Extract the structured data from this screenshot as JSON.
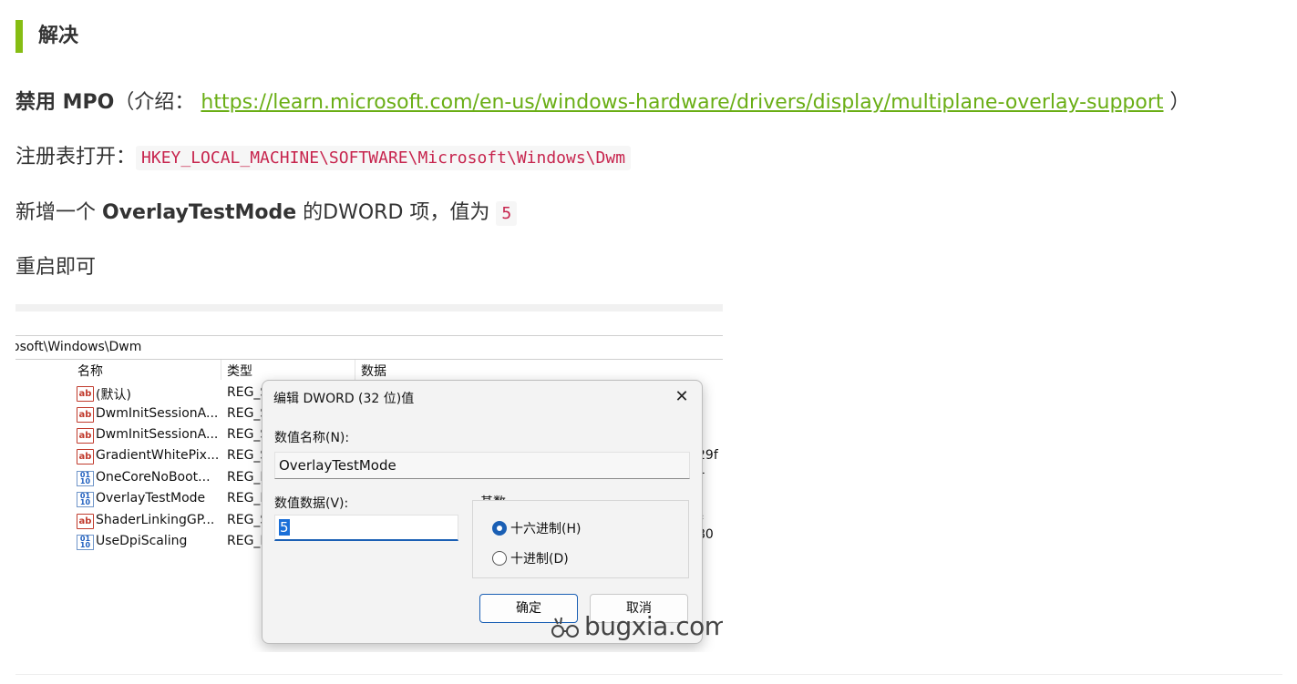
{
  "heading": "解决",
  "p1": {
    "bold": "禁用 MPO",
    "before_link": "（介绍：",
    "link": "https://learn.microsoft.com/en-us/windows-hardware/drivers/display/multiplane-overlay-support",
    "after_link": "）"
  },
  "p2": {
    "text": "注册表打开：",
    "code": "HKEY_LOCAL_MACHINE\\SOFTWARE\\Microsoft\\Windows\\Dwm"
  },
  "p3": {
    "before": "新增一个 ",
    "bold": "OverlayTestMode",
    "after": " 的DWORD 项，值为",
    "code": "5"
  },
  "p4": "重启即可",
  "screenshot": {
    "address": "osoft\\Windows\\Dwm",
    "columns": [
      "名称",
      "类型",
      "数据"
    ],
    "rows": [
      {
        "icon": "ab",
        "name": "(默认)",
        "type": "REG_S"
      },
      {
        "icon": "ab",
        "name": "DwmInitSessionA...",
        "type": "REG_S"
      },
      {
        "icon": "ab",
        "name": "DwmInitSessionA...",
        "type": "REG_S"
      },
      {
        "icon": "ab",
        "name": "GradientWhitePix...",
        "type": "REG_S"
      },
      {
        "icon": "bin",
        "name": "OneCoreNoBoot...",
        "type": "REG_I"
      },
      {
        "icon": "bin",
        "name": "OverlayTestMode",
        "type": "REG_I"
      },
      {
        "icon": "ab",
        "name": "ShaderLinkingGP...",
        "type": "REG_S"
      },
      {
        "icon": "bin",
        "name": "UseDpiScaling",
        "type": "REG_I"
      }
    ],
    "right_clip_1": "29f 1",
    "right_clip_2": "* 80",
    "icon_labels": {
      "ab": "ab",
      "bin": "01\n10"
    },
    "dialog": {
      "title": "编辑 DWORD (32 位)值",
      "close_glyph": "✕",
      "name_label": "数值名称(N):",
      "name_value": "OverlayTestMode",
      "data_label": "数值数据(V):",
      "data_value": "5",
      "base_label": "基数",
      "hex_label": "十六进制(H)",
      "dec_label": "十进制(D)",
      "selected_base": "hex",
      "ok": "确定",
      "cancel": "取消"
    },
    "watermark": "bugxia.com"
  },
  "colors": {
    "accent": "#86bd13",
    "link": "#6aae15",
    "code": "#c7254e"
  }
}
